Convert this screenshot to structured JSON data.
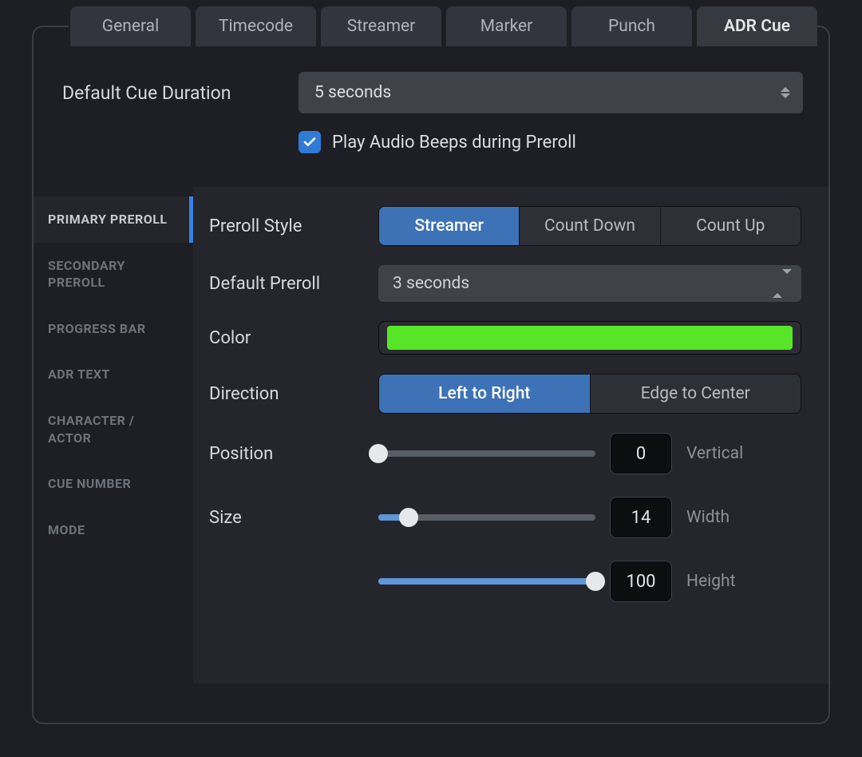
{
  "tabs": {
    "items": [
      {
        "label": "General"
      },
      {
        "label": "Timecode"
      },
      {
        "label": "Streamer"
      },
      {
        "label": "Marker"
      },
      {
        "label": "Punch"
      },
      {
        "label": "ADR Cue"
      }
    ],
    "active": 5
  },
  "default_cue_duration": {
    "label": "Default Cue Duration",
    "value": "5 seconds"
  },
  "play_beeps": {
    "label": "Play Audio Beeps during Preroll",
    "checked": true
  },
  "sidebar": {
    "items": [
      {
        "label": "PRIMARY PREROLL"
      },
      {
        "label": "SECONDARY PREROLL"
      },
      {
        "label": "PROGRESS BAR"
      },
      {
        "label": "ADR TEXT"
      },
      {
        "label": "CHARACTER / ACTOR"
      },
      {
        "label": "CUE NUMBER"
      },
      {
        "label": "MODE"
      }
    ],
    "active": 0
  },
  "preroll_style": {
    "label": "Preroll Style",
    "options": [
      "Streamer",
      "Count Down",
      "Count Up"
    ],
    "selected": 0
  },
  "default_preroll": {
    "label": "Default Preroll",
    "value": "3 seconds"
  },
  "color": {
    "label": "Color",
    "value": "#58e528"
  },
  "direction": {
    "label": "Direction",
    "options": [
      "Left to Right",
      "Edge to Center"
    ],
    "selected": 0
  },
  "position": {
    "label": "Position",
    "vertical": {
      "value": 0,
      "percent": 0,
      "sublabel": "Vertical"
    }
  },
  "size": {
    "label": "Size",
    "width": {
      "value": 14,
      "percent": 14,
      "sublabel": "Width"
    },
    "height": {
      "value": 100,
      "percent": 100,
      "sublabel": "Height"
    }
  }
}
